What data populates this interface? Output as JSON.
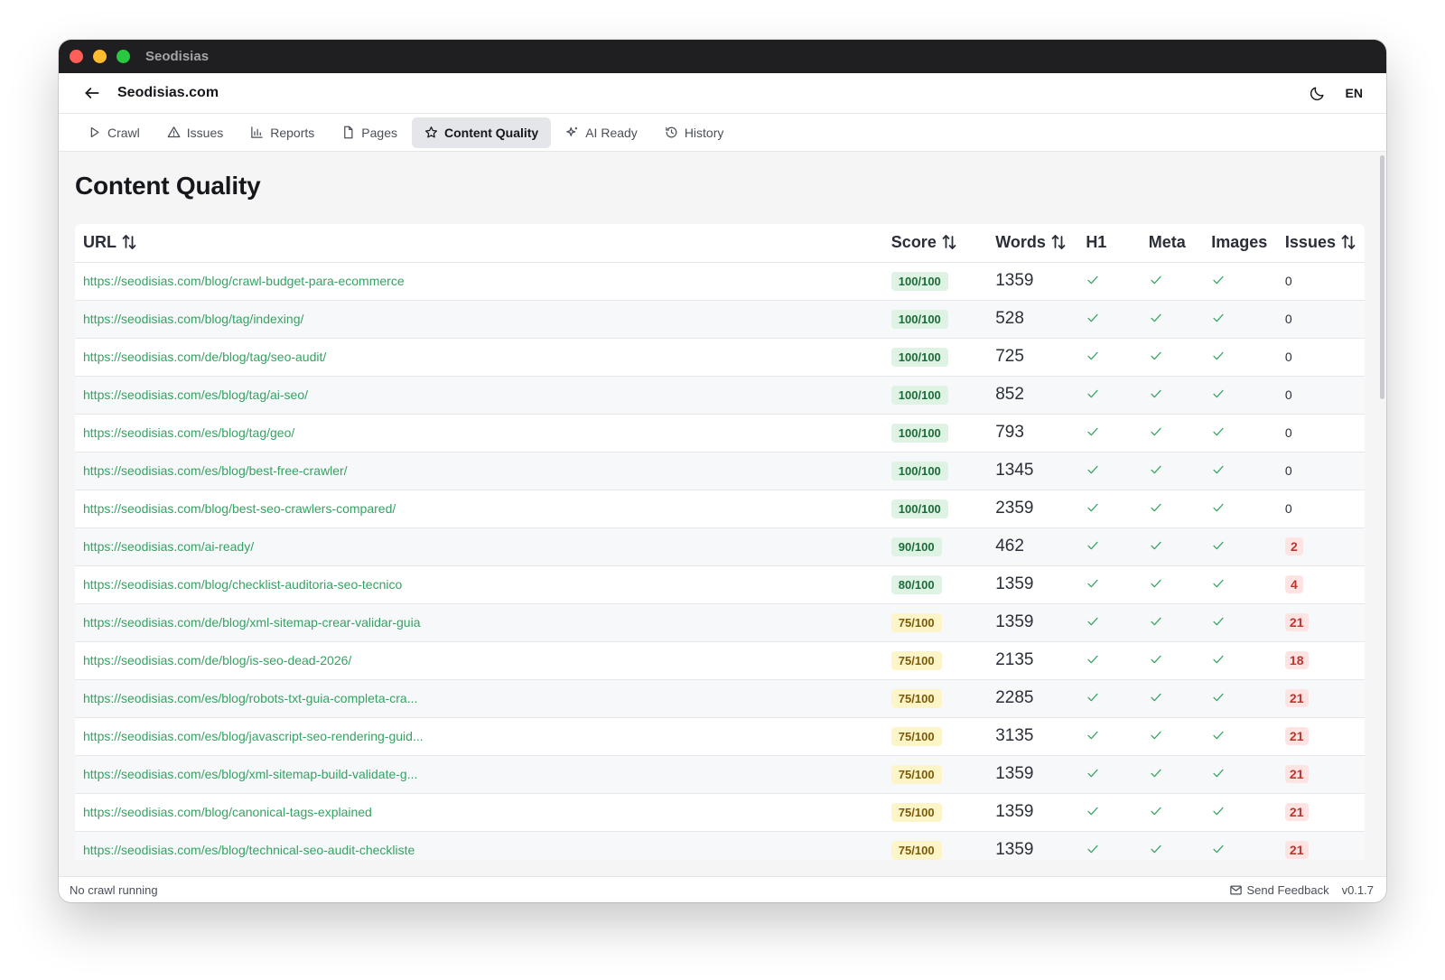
{
  "window": {
    "title": "Seodisias"
  },
  "header": {
    "site": "Seodisias.com",
    "lang": "EN"
  },
  "tabs": [
    {
      "label": "Crawl",
      "icon": "play-icon"
    },
    {
      "label": "Issues",
      "icon": "warning-icon"
    },
    {
      "label": "Reports",
      "icon": "bar-chart-icon"
    },
    {
      "label": "Pages",
      "icon": "file-icon"
    },
    {
      "label": "Content Quality",
      "icon": "star-icon",
      "active": true
    },
    {
      "label": "AI Ready",
      "icon": "sparkles-icon"
    },
    {
      "label": "History",
      "icon": "history-icon"
    }
  ],
  "page": {
    "title": "Content Quality"
  },
  "table": {
    "columns": [
      "URL",
      "Score",
      "Words",
      "H1",
      "Meta",
      "Images",
      "Issues"
    ],
    "rows": [
      {
        "url": "https://seodisias.com/blog/crawl-budget-para-ecommerce",
        "score": "100/100",
        "words": "1359",
        "issues": "0"
      },
      {
        "url": "https://seodisias.com/blog/tag/indexing/",
        "score": "100/100",
        "words": "528",
        "issues": "0"
      },
      {
        "url": "https://seodisias.com/de/blog/tag/seo-audit/",
        "score": "100/100",
        "words": "725",
        "issues": "0"
      },
      {
        "url": "https://seodisias.com/es/blog/tag/ai-seo/",
        "score": "100/100",
        "words": "852",
        "issues": "0"
      },
      {
        "url": "https://seodisias.com/es/blog/tag/geo/",
        "score": "100/100",
        "words": "793",
        "issues": "0"
      },
      {
        "url": "https://seodisias.com/es/blog/best-free-crawler/",
        "score": "100/100",
        "words": "1345",
        "issues": "0"
      },
      {
        "url": "https://seodisias.com/blog/best-seo-crawlers-compared/",
        "score": "100/100",
        "words": "2359",
        "issues": "0"
      },
      {
        "url": "https://seodisias.com/ai-ready/",
        "score": "90/100",
        "words": "462",
        "issues": "2"
      },
      {
        "url": "https://seodisias.com/blog/checklist-auditoria-seo-tecnico",
        "score": "80/100",
        "words": "1359",
        "issues": "4"
      },
      {
        "url": "https://seodisias.com/de/blog/xml-sitemap-crear-validar-guia",
        "score": "75/100",
        "words": "1359",
        "issues": "21"
      },
      {
        "url": "https://seodisias.com/de/blog/is-seo-dead-2026/",
        "score": "75/100",
        "words": "2135",
        "issues": "18"
      },
      {
        "url": "https://seodisias.com/es/blog/robots-txt-guia-completa-cra...",
        "score": "75/100",
        "words": "2285",
        "issues": "21"
      },
      {
        "url": "https://seodisias.com/es/blog/javascript-seo-rendering-guid...",
        "score": "75/100",
        "words": "3135",
        "issues": "21"
      },
      {
        "url": "https://seodisias.com/es/blog/xml-sitemap-build-validate-g...",
        "score": "75/100",
        "words": "1359",
        "issues": "21"
      },
      {
        "url": "https://seodisias.com/blog/canonical-tags-explained",
        "score": "75/100",
        "words": "1359",
        "issues": "21"
      },
      {
        "url": "https://seodisias.com/es/blog/technical-seo-audit-checkliste",
        "score": "75/100",
        "words": "1359",
        "issues": "21"
      }
    ]
  },
  "status": {
    "left": "No crawl running",
    "feedback": "Send Feedback",
    "version": "v0.1.7"
  },
  "colors": {
    "link": "#35a262",
    "score_green_bg": "#dff3e4",
    "score_yellow_bg": "#fdf5c8",
    "issue_bg": "#fde4e3",
    "issue_text": "#b9362f"
  }
}
